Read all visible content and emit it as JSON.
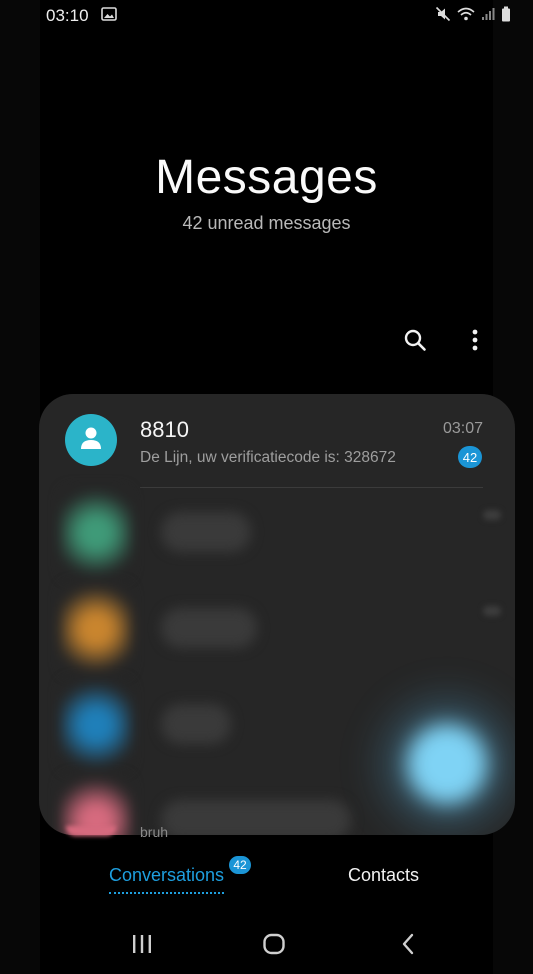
{
  "status_bar": {
    "time": "03:10",
    "left_icons": [
      "gallery-icon"
    ],
    "right_icons": [
      "mute-icon",
      "wifi-icon",
      "signal-icon",
      "battery-icon"
    ]
  },
  "header": {
    "title": "Messages",
    "subtitle": "42 unread messages"
  },
  "toolbar": {
    "icons": [
      "search-icon",
      "more-options-icon"
    ]
  },
  "conversations": [
    {
      "name": "8810",
      "preview": "De Lijn, uw verificatiecode is: 328672",
      "time": "03:07",
      "unread": "42",
      "avatar_color": "#2bb4c9"
    }
  ],
  "blurred_avatar_colors": [
    "#3f9a78",
    "#c9852e",
    "#1f7fb9",
    "#d66a7e"
  ],
  "peek_text": "bruh",
  "tabs": {
    "conversations_label": "Conversations",
    "conversations_badge": "42",
    "contacts_label": "Contacts"
  },
  "nav_bar": {
    "icons": [
      "recent-apps-icon",
      "home-icon",
      "back-icon"
    ]
  },
  "colors": {
    "accent": "#1e9fdf",
    "badge": "#1b95d6",
    "card_background": "#262626",
    "background": "#000000"
  }
}
